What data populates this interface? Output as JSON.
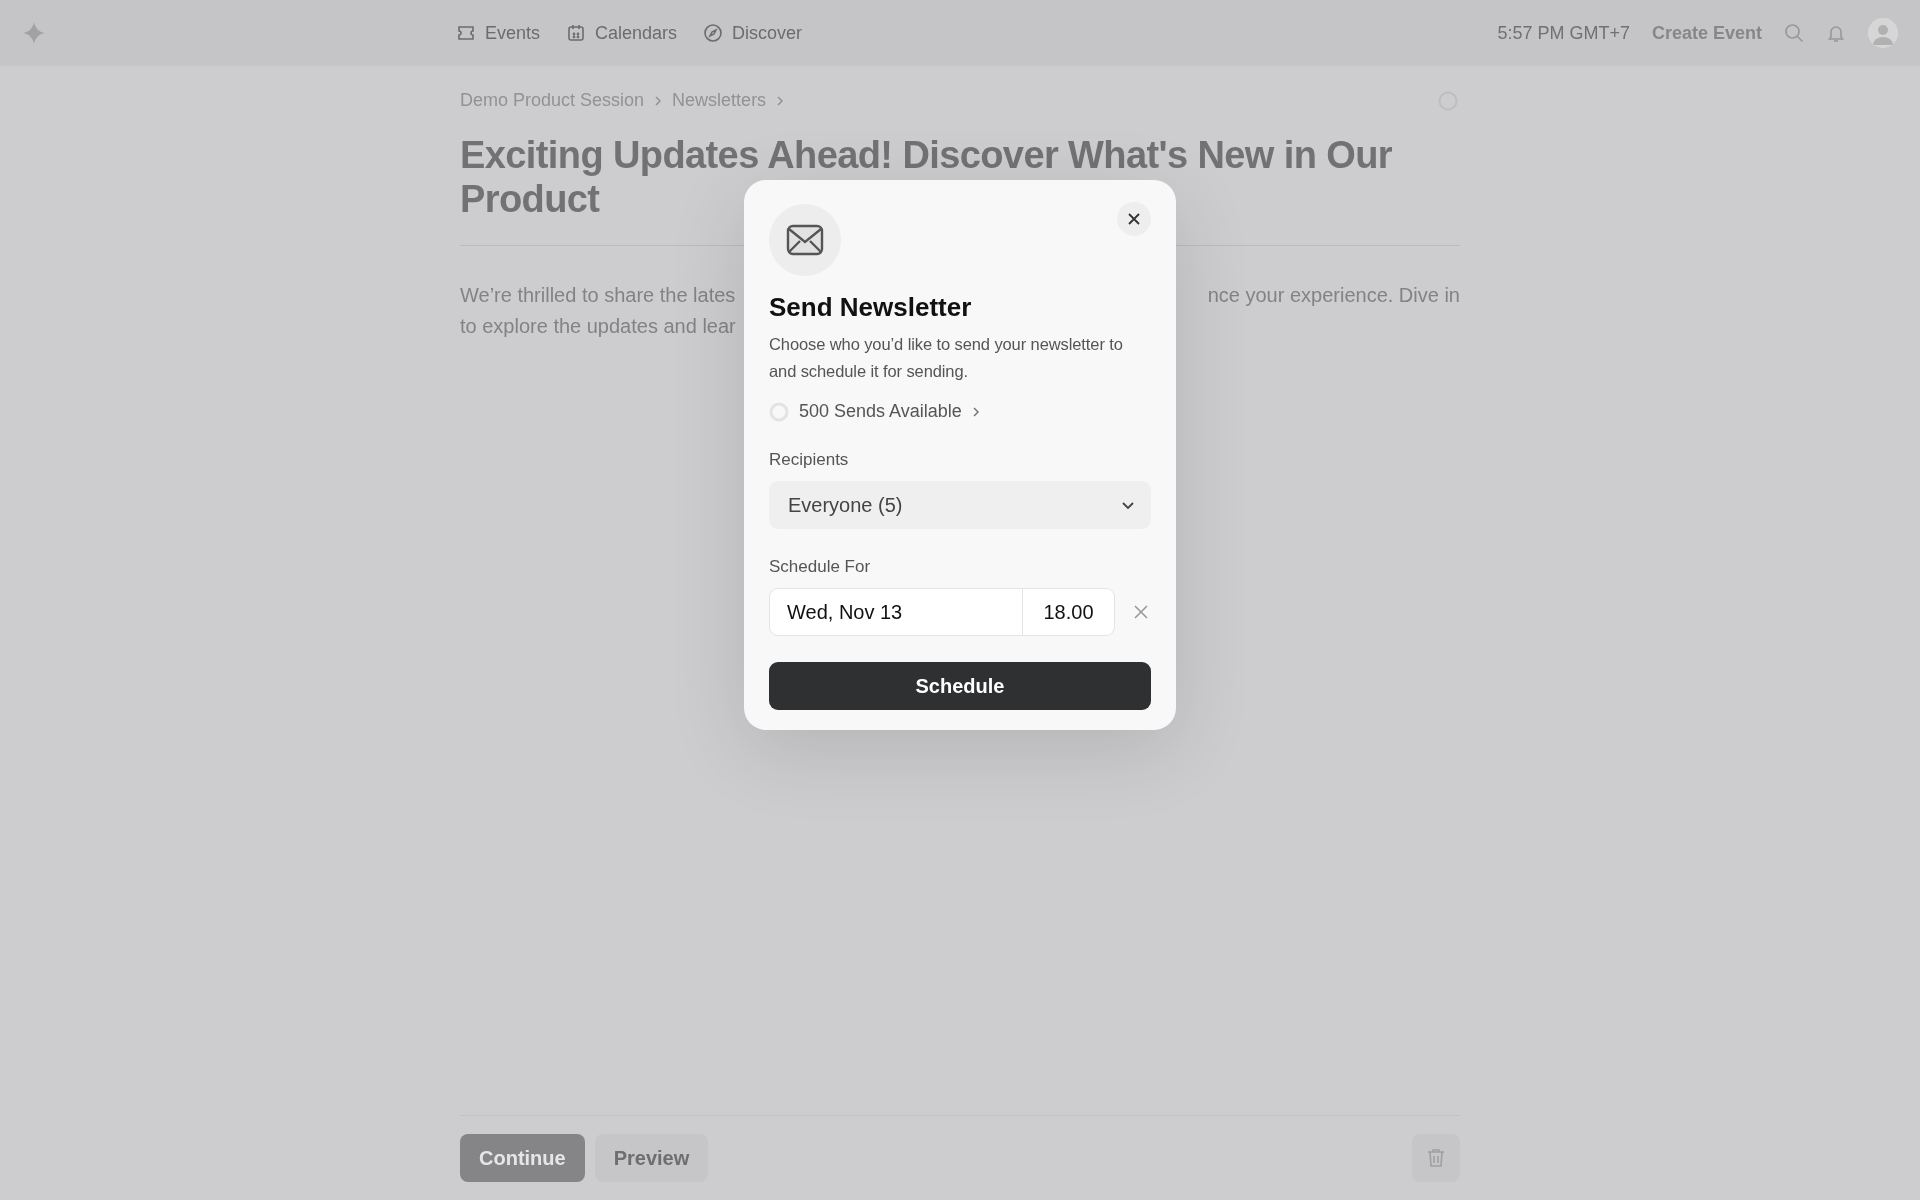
{
  "nav": {
    "items": [
      {
        "kind": "ticket",
        "label": "Events"
      },
      {
        "kind": "calendar",
        "label": "Calendars"
      },
      {
        "kind": "compass",
        "label": "Discover"
      }
    ],
    "time": "5:57 PM GMT+7",
    "create_event": "Create Event"
  },
  "breadcrumb": [
    "Demo Product Session",
    "Newsletters"
  ],
  "title_lines": [
    "Exciting Updates Ahead! Discover What's New in Our",
    "Product"
  ],
  "intro_lines": [
    [
      "We’re thrilled to share the lates",
      "nce your experience. Dive in"
    ],
    [
      "to explore the updates and lear"
    ]
  ],
  "footer": {
    "continue": "Continue",
    "preview": "Preview"
  },
  "dialog": {
    "title": "Send Newsletter",
    "description": "Choose who you’d like to send your newsletter to and schedule it for sending.",
    "sends": "500 Sends Available",
    "recipients_label": "Recipients",
    "recipients_value": "Everyone (5)",
    "schedule_label": "Schedule For",
    "date": "Wed, Nov 13",
    "time": "18.00",
    "submit": "Schedule"
  }
}
